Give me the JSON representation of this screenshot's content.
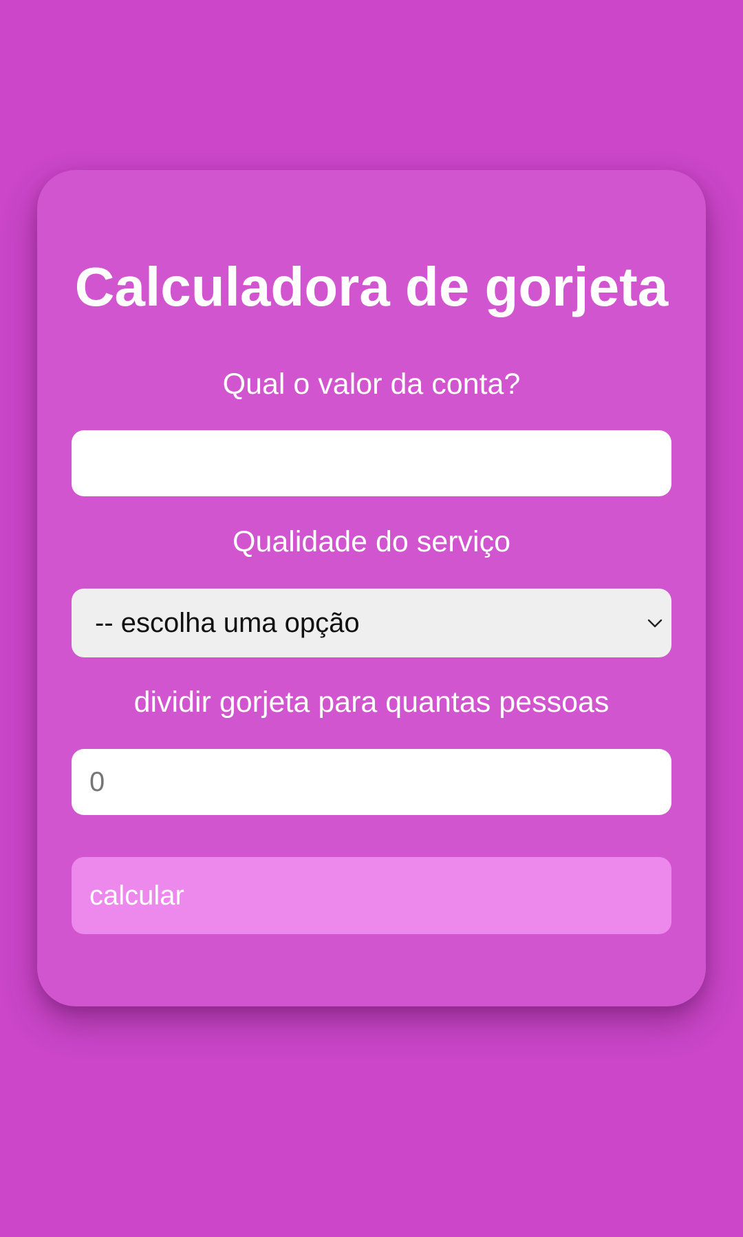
{
  "card": {
    "title": "Calculadora de gorjeta",
    "bill": {
      "label": "Qual o valor da conta?",
      "value": ""
    },
    "service": {
      "label": "Qualidade do serviço",
      "selected": "-- escolha uma opção",
      "icon": "chevron-down-icon"
    },
    "people": {
      "label": "dividir gorjeta para quantas pessoas",
      "placeholder": "0"
    },
    "calculate_button": "calcular"
  },
  "colors": {
    "background": "#cb46c9",
    "card": "#d055ce",
    "button": "#ed89ec",
    "select": "#efefef",
    "text": "#ffffff"
  }
}
